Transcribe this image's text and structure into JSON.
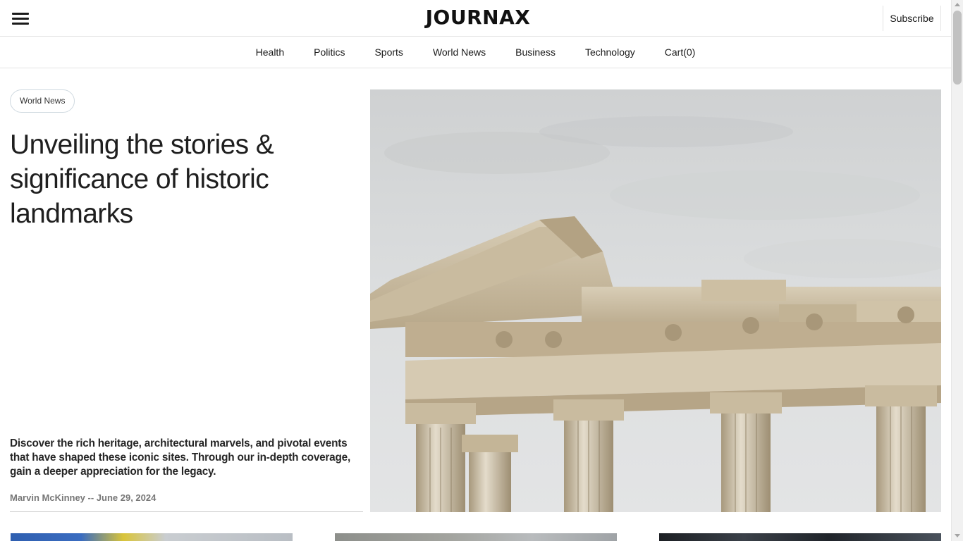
{
  "header": {
    "logo": "JOURNAX",
    "subscribe_label": "Subscribe"
  },
  "nav": {
    "items": [
      "Health",
      "Politics",
      "Sports",
      "World News",
      "Business",
      "Technology",
      "Cart(0)"
    ]
  },
  "featured": {
    "category": "World News",
    "headline": "Unveiling the stories & significance of historic landmarks",
    "summary": "Discover the rich heritage, architectural marvels, and pivotal events that have shaped these iconic sites. Through our in-depth coverage, gain a deeper appreciation for the legacy.",
    "byline": "Marvin McKinney -- June 29, 2024",
    "image_subject": "ancient-temple-ruins"
  },
  "icons": {
    "menu": "hamburger-menu-icon"
  },
  "colors": {
    "text": "#1a1a1a",
    "muted": "#777777",
    "border": "#e3e3e3",
    "badge_border": "#cfd9e0"
  }
}
